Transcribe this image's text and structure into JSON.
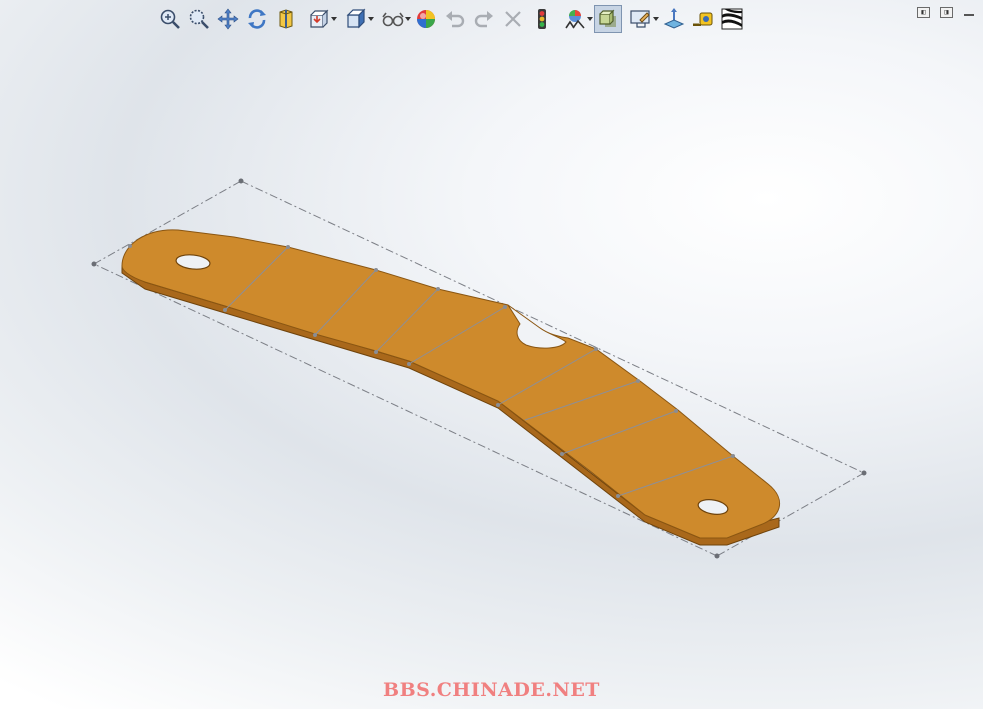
{
  "toolbar": {
    "items": [
      {
        "icon": "zoom-to-fit-icon"
      },
      {
        "icon": "zoom-to-area-icon"
      },
      {
        "icon": "pan-icon"
      },
      {
        "icon": "rotate-icon"
      },
      {
        "icon": "section-view-icon"
      },
      {
        "icon": "view-orientation-icon",
        "dropdown": true
      },
      {
        "icon": "display-style-icon",
        "dropdown": true
      },
      {
        "icon": "hide-show-items-icon",
        "dropdown": true
      },
      {
        "icon": "edit-appearance-icon"
      },
      {
        "icon": "undo-icon",
        "disabled": true
      },
      {
        "icon": "redo-icon",
        "disabled": true
      },
      {
        "icon": "cancel-icon",
        "disabled": true
      },
      {
        "icon": "traffic-light-icon"
      },
      {
        "icon": "apply-scene-icon",
        "dropdown": true
      },
      {
        "icon": "shadows-icon",
        "active": true
      },
      {
        "icon": "view-settings-icon",
        "dropdown": true
      },
      {
        "icon": "triad-icon"
      },
      {
        "icon": "measure-icon"
      },
      {
        "icon": "zebra-stripes-icon"
      }
    ]
  },
  "window_controls": {
    "restore_left": "◧",
    "restore_right": "◨"
  },
  "colors": {
    "part_fill": "#CE8A2C",
    "part_edge": "#8A5612",
    "sketch_lines": "#7C7F86",
    "watermark": "#F08080"
  },
  "watermark": "BBS.CHINADE.NET"
}
